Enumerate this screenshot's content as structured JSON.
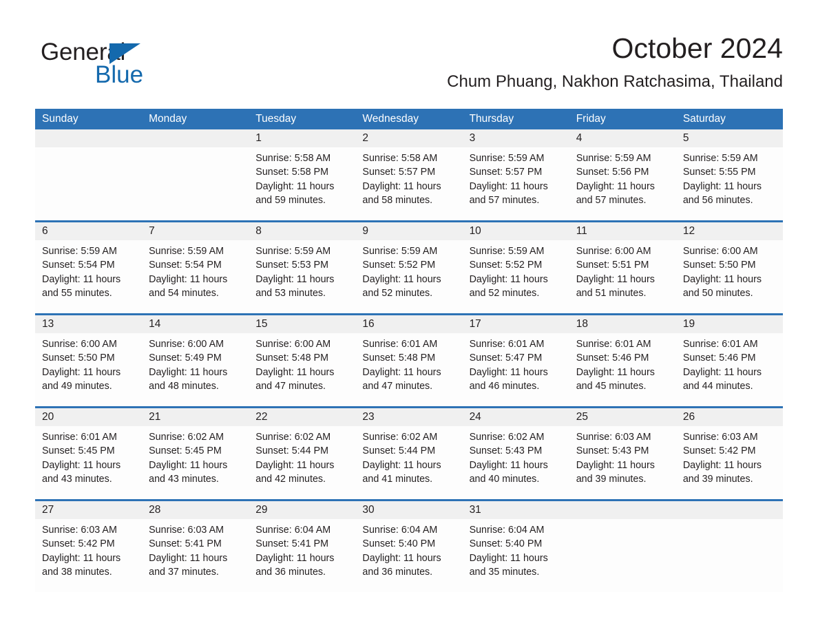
{
  "brand": {
    "name_part1": "General",
    "name_part2": "Blue",
    "triangle_color": "#1469ad",
    "accent_color": "#2d72b5"
  },
  "header": {
    "month_title": "October 2024",
    "location": "Chum Phuang, Nakhon Ratchasima, Thailand"
  },
  "calendar": {
    "weekdays": [
      "Sunday",
      "Monday",
      "Tuesday",
      "Wednesday",
      "Thursday",
      "Friday",
      "Saturday"
    ],
    "weeks": [
      [
        {
          "date": "",
          "sunrise": "",
          "sunset": "",
          "daylight_line1": "",
          "daylight_line2": ""
        },
        {
          "date": "",
          "sunrise": "",
          "sunset": "",
          "daylight_line1": "",
          "daylight_line2": ""
        },
        {
          "date": "1",
          "sunrise": "Sunrise: 5:58 AM",
          "sunset": "Sunset: 5:58 PM",
          "daylight_line1": "Daylight: 11 hours",
          "daylight_line2": "and 59 minutes."
        },
        {
          "date": "2",
          "sunrise": "Sunrise: 5:58 AM",
          "sunset": "Sunset: 5:57 PM",
          "daylight_line1": "Daylight: 11 hours",
          "daylight_line2": "and 58 minutes."
        },
        {
          "date": "3",
          "sunrise": "Sunrise: 5:59 AM",
          "sunset": "Sunset: 5:57 PM",
          "daylight_line1": "Daylight: 11 hours",
          "daylight_line2": "and 57 minutes."
        },
        {
          "date": "4",
          "sunrise": "Sunrise: 5:59 AM",
          "sunset": "Sunset: 5:56 PM",
          "daylight_line1": "Daylight: 11 hours",
          "daylight_line2": "and 57 minutes."
        },
        {
          "date": "5",
          "sunrise": "Sunrise: 5:59 AM",
          "sunset": "Sunset: 5:55 PM",
          "daylight_line1": "Daylight: 11 hours",
          "daylight_line2": "and 56 minutes."
        }
      ],
      [
        {
          "date": "6",
          "sunrise": "Sunrise: 5:59 AM",
          "sunset": "Sunset: 5:54 PM",
          "daylight_line1": "Daylight: 11 hours",
          "daylight_line2": "and 55 minutes."
        },
        {
          "date": "7",
          "sunrise": "Sunrise: 5:59 AM",
          "sunset": "Sunset: 5:54 PM",
          "daylight_line1": "Daylight: 11 hours",
          "daylight_line2": "and 54 minutes."
        },
        {
          "date": "8",
          "sunrise": "Sunrise: 5:59 AM",
          "sunset": "Sunset: 5:53 PM",
          "daylight_line1": "Daylight: 11 hours",
          "daylight_line2": "and 53 minutes."
        },
        {
          "date": "9",
          "sunrise": "Sunrise: 5:59 AM",
          "sunset": "Sunset: 5:52 PM",
          "daylight_line1": "Daylight: 11 hours",
          "daylight_line2": "and 52 minutes."
        },
        {
          "date": "10",
          "sunrise": "Sunrise: 5:59 AM",
          "sunset": "Sunset: 5:52 PM",
          "daylight_line1": "Daylight: 11 hours",
          "daylight_line2": "and 52 minutes."
        },
        {
          "date": "11",
          "sunrise": "Sunrise: 6:00 AM",
          "sunset": "Sunset: 5:51 PM",
          "daylight_line1": "Daylight: 11 hours",
          "daylight_line2": "and 51 minutes."
        },
        {
          "date": "12",
          "sunrise": "Sunrise: 6:00 AM",
          "sunset": "Sunset: 5:50 PM",
          "daylight_line1": "Daylight: 11 hours",
          "daylight_line2": "and 50 minutes."
        }
      ],
      [
        {
          "date": "13",
          "sunrise": "Sunrise: 6:00 AM",
          "sunset": "Sunset: 5:50 PM",
          "daylight_line1": "Daylight: 11 hours",
          "daylight_line2": "and 49 minutes."
        },
        {
          "date": "14",
          "sunrise": "Sunrise: 6:00 AM",
          "sunset": "Sunset: 5:49 PM",
          "daylight_line1": "Daylight: 11 hours",
          "daylight_line2": "and 48 minutes."
        },
        {
          "date": "15",
          "sunrise": "Sunrise: 6:00 AM",
          "sunset": "Sunset: 5:48 PM",
          "daylight_line1": "Daylight: 11 hours",
          "daylight_line2": "and 47 minutes."
        },
        {
          "date": "16",
          "sunrise": "Sunrise: 6:01 AM",
          "sunset": "Sunset: 5:48 PM",
          "daylight_line1": "Daylight: 11 hours",
          "daylight_line2": "and 47 minutes."
        },
        {
          "date": "17",
          "sunrise": "Sunrise: 6:01 AM",
          "sunset": "Sunset: 5:47 PM",
          "daylight_line1": "Daylight: 11 hours",
          "daylight_line2": "and 46 minutes."
        },
        {
          "date": "18",
          "sunrise": "Sunrise: 6:01 AM",
          "sunset": "Sunset: 5:46 PM",
          "daylight_line1": "Daylight: 11 hours",
          "daylight_line2": "and 45 minutes."
        },
        {
          "date": "19",
          "sunrise": "Sunrise: 6:01 AM",
          "sunset": "Sunset: 5:46 PM",
          "daylight_line1": "Daylight: 11 hours",
          "daylight_line2": "and 44 minutes."
        }
      ],
      [
        {
          "date": "20",
          "sunrise": "Sunrise: 6:01 AM",
          "sunset": "Sunset: 5:45 PM",
          "daylight_line1": "Daylight: 11 hours",
          "daylight_line2": "and 43 minutes."
        },
        {
          "date": "21",
          "sunrise": "Sunrise: 6:02 AM",
          "sunset": "Sunset: 5:45 PM",
          "daylight_line1": "Daylight: 11 hours",
          "daylight_line2": "and 43 minutes."
        },
        {
          "date": "22",
          "sunrise": "Sunrise: 6:02 AM",
          "sunset": "Sunset: 5:44 PM",
          "daylight_line1": "Daylight: 11 hours",
          "daylight_line2": "and 42 minutes."
        },
        {
          "date": "23",
          "sunrise": "Sunrise: 6:02 AM",
          "sunset": "Sunset: 5:44 PM",
          "daylight_line1": "Daylight: 11 hours",
          "daylight_line2": "and 41 minutes."
        },
        {
          "date": "24",
          "sunrise": "Sunrise: 6:02 AM",
          "sunset": "Sunset: 5:43 PM",
          "daylight_line1": "Daylight: 11 hours",
          "daylight_line2": "and 40 minutes."
        },
        {
          "date": "25",
          "sunrise": "Sunrise: 6:03 AM",
          "sunset": "Sunset: 5:43 PM",
          "daylight_line1": "Daylight: 11 hours",
          "daylight_line2": "and 39 minutes."
        },
        {
          "date": "26",
          "sunrise": "Sunrise: 6:03 AM",
          "sunset": "Sunset: 5:42 PM",
          "daylight_line1": "Daylight: 11 hours",
          "daylight_line2": "and 39 minutes."
        }
      ],
      [
        {
          "date": "27",
          "sunrise": "Sunrise: 6:03 AM",
          "sunset": "Sunset: 5:42 PM",
          "daylight_line1": "Daylight: 11 hours",
          "daylight_line2": "and 38 minutes."
        },
        {
          "date": "28",
          "sunrise": "Sunrise: 6:03 AM",
          "sunset": "Sunset: 5:41 PM",
          "daylight_line1": "Daylight: 11 hours",
          "daylight_line2": "and 37 minutes."
        },
        {
          "date": "29",
          "sunrise": "Sunrise: 6:04 AM",
          "sunset": "Sunset: 5:41 PM",
          "daylight_line1": "Daylight: 11 hours",
          "daylight_line2": "and 36 minutes."
        },
        {
          "date": "30",
          "sunrise": "Sunrise: 6:04 AM",
          "sunset": "Sunset: 5:40 PM",
          "daylight_line1": "Daylight: 11 hours",
          "daylight_line2": "and 36 minutes."
        },
        {
          "date": "31",
          "sunrise": "Sunrise: 6:04 AM",
          "sunset": "Sunset: 5:40 PM",
          "daylight_line1": "Daylight: 11 hours",
          "daylight_line2": "and 35 minutes."
        },
        {
          "date": "",
          "sunrise": "",
          "sunset": "",
          "daylight_line1": "",
          "daylight_line2": ""
        },
        {
          "date": "",
          "sunrise": "",
          "sunset": "",
          "daylight_line1": "",
          "daylight_line2": ""
        }
      ]
    ]
  }
}
